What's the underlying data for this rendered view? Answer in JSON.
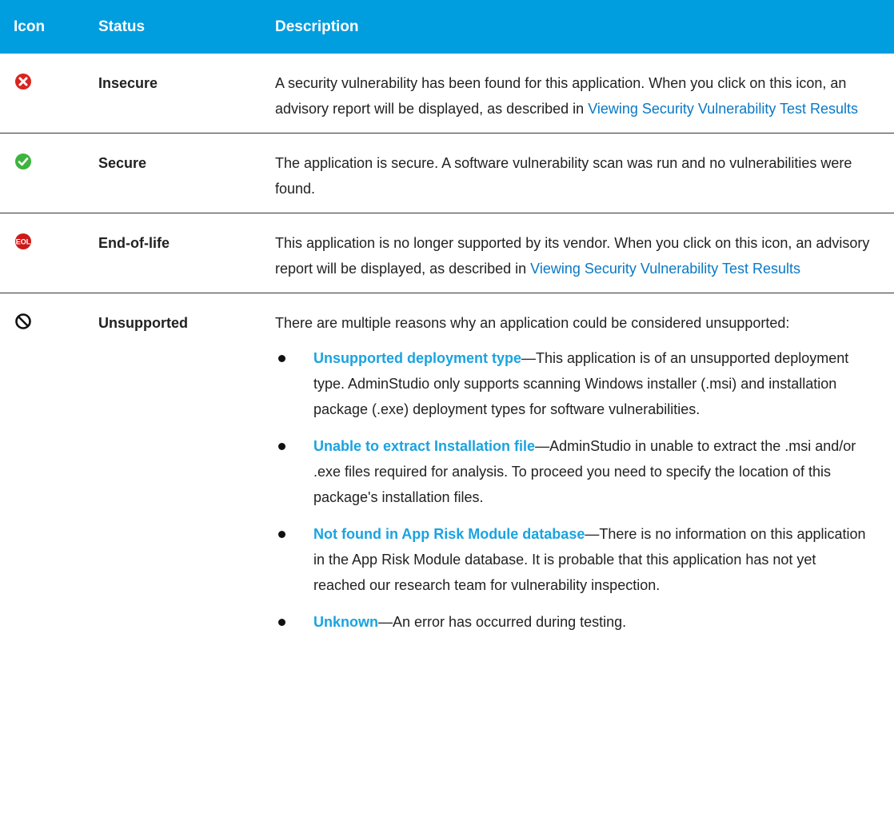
{
  "header": {
    "icon": "Icon",
    "status": "Status",
    "description": "Description"
  },
  "rows": [
    {
      "icon": "red-x-circle-icon",
      "status": "Insecure",
      "text": "A security vulnerability has been found for this application. When you click on this icon, an advisory report will be displayed, as described in ",
      "link": "Viewing Security Vulnerability Test Results"
    },
    {
      "icon": "green-check-circle-icon",
      "status": "Secure",
      "text": "The application is secure. A software vulnerability scan was run and no vulnerabilities were found."
    },
    {
      "icon": "eol-badge-icon",
      "icon_text": "EOL",
      "status": "End-of-life",
      "text": "This application is no longer supported by its vendor. When you click on this icon, an advisory report will be displayed, as described in ",
      "link": "Viewing Security Vulnerability Test Results"
    },
    {
      "icon": "prohibited-icon",
      "status": "Unsupported",
      "text": "There are multiple reasons why an application could be considered unsupported:",
      "bullets": [
        {
          "term": "Unsupported deployment type",
          "text": "—This application is of an unsupported deployment type. AdminStudio only supports scanning Windows installer (.msi) and installation package (.exe) deployment types for software vulnerabilities."
        },
        {
          "term": "Unable to extract Installation file",
          "text": "—AdminStudio in unable to extract the .msi and/or .exe files required for analysis. To proceed you need to specify the location of this package's installation files."
        },
        {
          "term": "Not found in App Risk Module database",
          "text": "—There is no information on this application in the App Risk Module database. It is probable that this application has not yet reached our research team for vulnerability inspection."
        },
        {
          "term": "Unknown",
          "text": "—An error has occurred during testing."
        }
      ]
    }
  ],
  "colors": {
    "header_bg": "#009ddf",
    "link": "#0a79c5",
    "term": "#1aa3e0",
    "insecure": "#d9241f",
    "secure": "#3db43d",
    "eol": "#cc1a1a"
  }
}
